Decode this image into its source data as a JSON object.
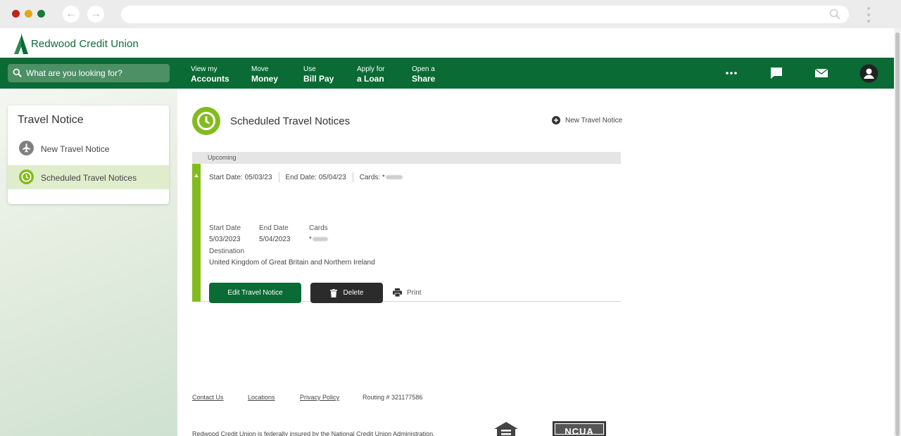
{
  "brand": {
    "name": "Redwood Credit Union",
    "primary_color": "#0a6b35",
    "accent_color": "#82bc1c"
  },
  "search": {
    "placeholder": "What are you looking for?"
  },
  "nav": [
    {
      "line1": "View my",
      "line2": "Accounts"
    },
    {
      "line1": "Move",
      "line2": "Money"
    },
    {
      "line1": "Use",
      "line2": "Bill Pay"
    },
    {
      "line1": "Apply for",
      "line2": "a Loan"
    },
    {
      "line1": "Open a",
      "line2": "Share"
    }
  ],
  "nav_icons": [
    "more-icon",
    "chat-icon",
    "mail-icon",
    "profile-icon"
  ],
  "sidebar": {
    "title": "Travel Notice",
    "items": [
      {
        "label": "New Travel Notice",
        "icon": "airplane-icon",
        "active": false
      },
      {
        "label": "Scheduled Travel Notices",
        "icon": "clock-icon",
        "active": true
      }
    ]
  },
  "main": {
    "title": "Scheduled Travel Notices",
    "new_notice_label": "New Travel Notice",
    "section_label": "Upcoming",
    "notice": {
      "summary_start": "Start Date: 05/03/23",
      "summary_end": "End Date: 05/04/23",
      "summary_cards": "Cards: *",
      "start_date_label": "Start Date",
      "start_date_value": "5/03/2023",
      "end_date_label": "End Date",
      "end_date_value": "5/04/2023",
      "cards_label": "Cards",
      "cards_value": "*",
      "destination_label": "Destination",
      "destination_value": "United Kingdom of Great Britain and Northern Ireland",
      "edit_label": "Edit Travel Notice",
      "delete_label": "Delete",
      "print_label": "Print"
    }
  },
  "footer": {
    "links": [
      "Contact Us",
      "Locations",
      "Privacy Policy"
    ],
    "routing": "Routing # 321177586",
    "disclaimer": "Redwood Credit Union is federally insured by the National Credit Union Administration.",
    "ncua_label": "NCUA"
  }
}
